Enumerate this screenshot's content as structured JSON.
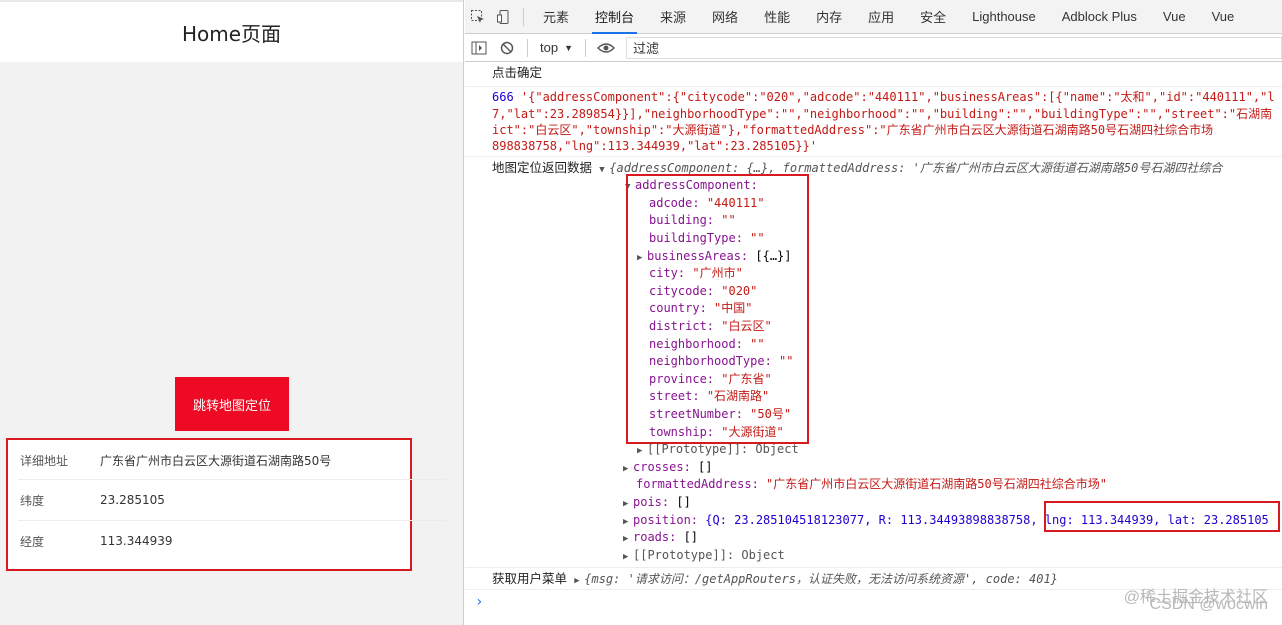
{
  "app": {
    "title": "Home页面",
    "jump_button": "跳转地图定位",
    "cells": [
      {
        "label": "详细地址",
        "value": "广东省广州市白云区大源街道石湖南路50号"
      },
      {
        "label": "纬度",
        "value": "23.285105"
      },
      {
        "label": "经度",
        "value": "113.344939"
      }
    ]
  },
  "devtools": {
    "tabs": [
      "元素",
      "控制台",
      "来源",
      "网络",
      "性能",
      "内存",
      "应用",
      "安全",
      "Lighthouse",
      "Adblock Plus",
      "Vue",
      "Vue"
    ],
    "active_tab": "控制台",
    "context": "top",
    "filter_placeholder": "过滤",
    "console": {
      "click_confirm": "点击确定",
      "json_prefix": "666 ",
      "json_lines": [
        "'{\"addressComponent\":{\"citycode\":\"020\",\"adcode\":\"440111\",\"businessAreas\":[{\"name\":\"太和\",\"id\":\"440111\",\"l",
        "7,\"lat\":23.289854}}],\"neighborhoodType\":\"\",\"neighborhood\":\"\",\"building\":\"\",\"buildingType\":\"\",\"street\":\"石湖南",
        "ict\":\"白云区\",\"township\":\"大源街道\"},\"formattedAddress\":\"广东省广州市白云区大源街道石湖南路50号石湖四社综合市场",
        "898838758,\"lng\":113.344939,\"lat\":23.285105}}'"
      ],
      "map_label": "地图定位返回数据",
      "map_summary": "{addressComponent: {…}, formattedAddress: '广东省广州市白云区大源街道石湖南路50号石湖四社综合",
      "address_component_key": "addressComponent:",
      "address_fields": [
        {
          "key": "adcode",
          "value": "\"440111\""
        },
        {
          "key": "building",
          "value": "\"\""
        },
        {
          "key": "buildingType",
          "value": "\"\""
        },
        {
          "key": "businessAreas",
          "value": "[{…}]"
        },
        {
          "key": "city",
          "value": "\"广州市\""
        },
        {
          "key": "citycode",
          "value": "\"020\""
        },
        {
          "key": "country",
          "value": "\"中国\""
        },
        {
          "key": "district",
          "value": "\"白云区\""
        },
        {
          "key": "neighborhood",
          "value": "\"\""
        },
        {
          "key": "neighborhoodType",
          "value": "\"\""
        },
        {
          "key": "province",
          "value": "\"广东省\""
        },
        {
          "key": "street",
          "value": "\"石湖南路\""
        },
        {
          "key": "streetNumber",
          "value": "\"50号\""
        },
        {
          "key": "township",
          "value": "\"大源街道\""
        }
      ],
      "prototype_inner": "[[Prototype]]: Object",
      "crosses": {
        "key": "crosses",
        "value": "[]"
      },
      "formatted": {
        "key": "formattedAddress",
        "value": "\"广东省广州市白云区大源街道石湖南路50号石湖四社综合市场\""
      },
      "pois": {
        "key": "pois",
        "value": "[]"
      },
      "position": {
        "key": "position",
        "value": "{Q: 23.285104518123077, R: 113.34493898838758, ",
        "tail": "lng: 113.344939, lat: 23.285105"
      },
      "roads": {
        "key": "roads",
        "value": "[]"
      },
      "prototype_outer": "[[Prototype]]: Object",
      "user_menu_label": "获取用户菜单",
      "user_menu_value": "{msg: '请求访问：/getAppRouters，认证失败，无法访问系统资源', code: 401}"
    },
    "prompt": "›"
  },
  "watermark": {
    "line1": "@稀土掘金技术社区",
    "line2": "CSDN @wocwin"
  },
  "colors": {
    "accent_red": "#ee0a24",
    "highlight_box": "#d71920",
    "string": "#c41a16",
    "key": "#881391",
    "number": "#1c00cf"
  }
}
